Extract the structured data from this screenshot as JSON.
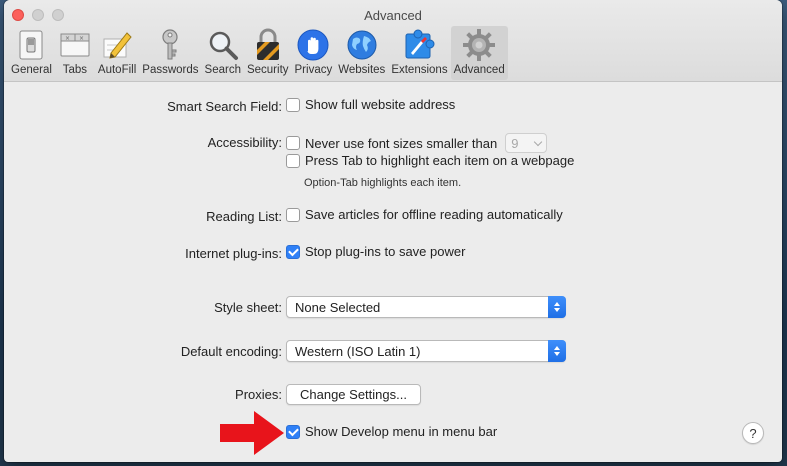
{
  "window": {
    "title": "Advanced"
  },
  "toolbar": {
    "items": [
      {
        "label": "General",
        "icon": "general-switch-icon"
      },
      {
        "label": "Tabs",
        "icon": "tabs-icon"
      },
      {
        "label": "AutoFill",
        "icon": "autofill-pencil-icon"
      },
      {
        "label": "Passwords",
        "icon": "key-icon"
      },
      {
        "label": "Search",
        "icon": "magnifier-icon"
      },
      {
        "label": "Security",
        "icon": "padlock-icon"
      },
      {
        "label": "Privacy",
        "icon": "hand-icon"
      },
      {
        "label": "Websites",
        "icon": "globe-icon"
      },
      {
        "label": "Extensions",
        "icon": "puzzle-icon"
      },
      {
        "label": "Advanced",
        "icon": "gear-icon",
        "selected": true
      }
    ]
  },
  "settings": {
    "smart_search": {
      "label": "Smart Search Field:",
      "option": "Show full website address",
      "checked": false
    },
    "accessibility": {
      "label": "Accessibility:",
      "font_size_option": "Never use font sizes smaller than",
      "font_size_value": "9",
      "font_size_checked": false,
      "tab_option": "Press Tab to highlight each item on a webpage",
      "tab_checked": false,
      "tab_hint": "Option-Tab highlights each item."
    },
    "reading_list": {
      "label": "Reading List:",
      "option": "Save articles for offline reading automatically",
      "checked": false
    },
    "plugins": {
      "label": "Internet plug-ins:",
      "option": "Stop plug-ins to save power",
      "checked": true
    },
    "style_sheet": {
      "label": "Style sheet:",
      "value": "None Selected"
    },
    "encoding": {
      "label": "Default encoding:",
      "value": "Western (ISO Latin 1)"
    },
    "proxies": {
      "label": "Proxies:",
      "button": "Change Settings..."
    },
    "develop": {
      "option": "Show Develop menu in menu bar",
      "checked": true
    },
    "help": {
      "label": "?"
    }
  },
  "colors": {
    "accent": "#2f80f7",
    "close_button": "#fc605b",
    "annotation_arrow": "#e8141b"
  }
}
